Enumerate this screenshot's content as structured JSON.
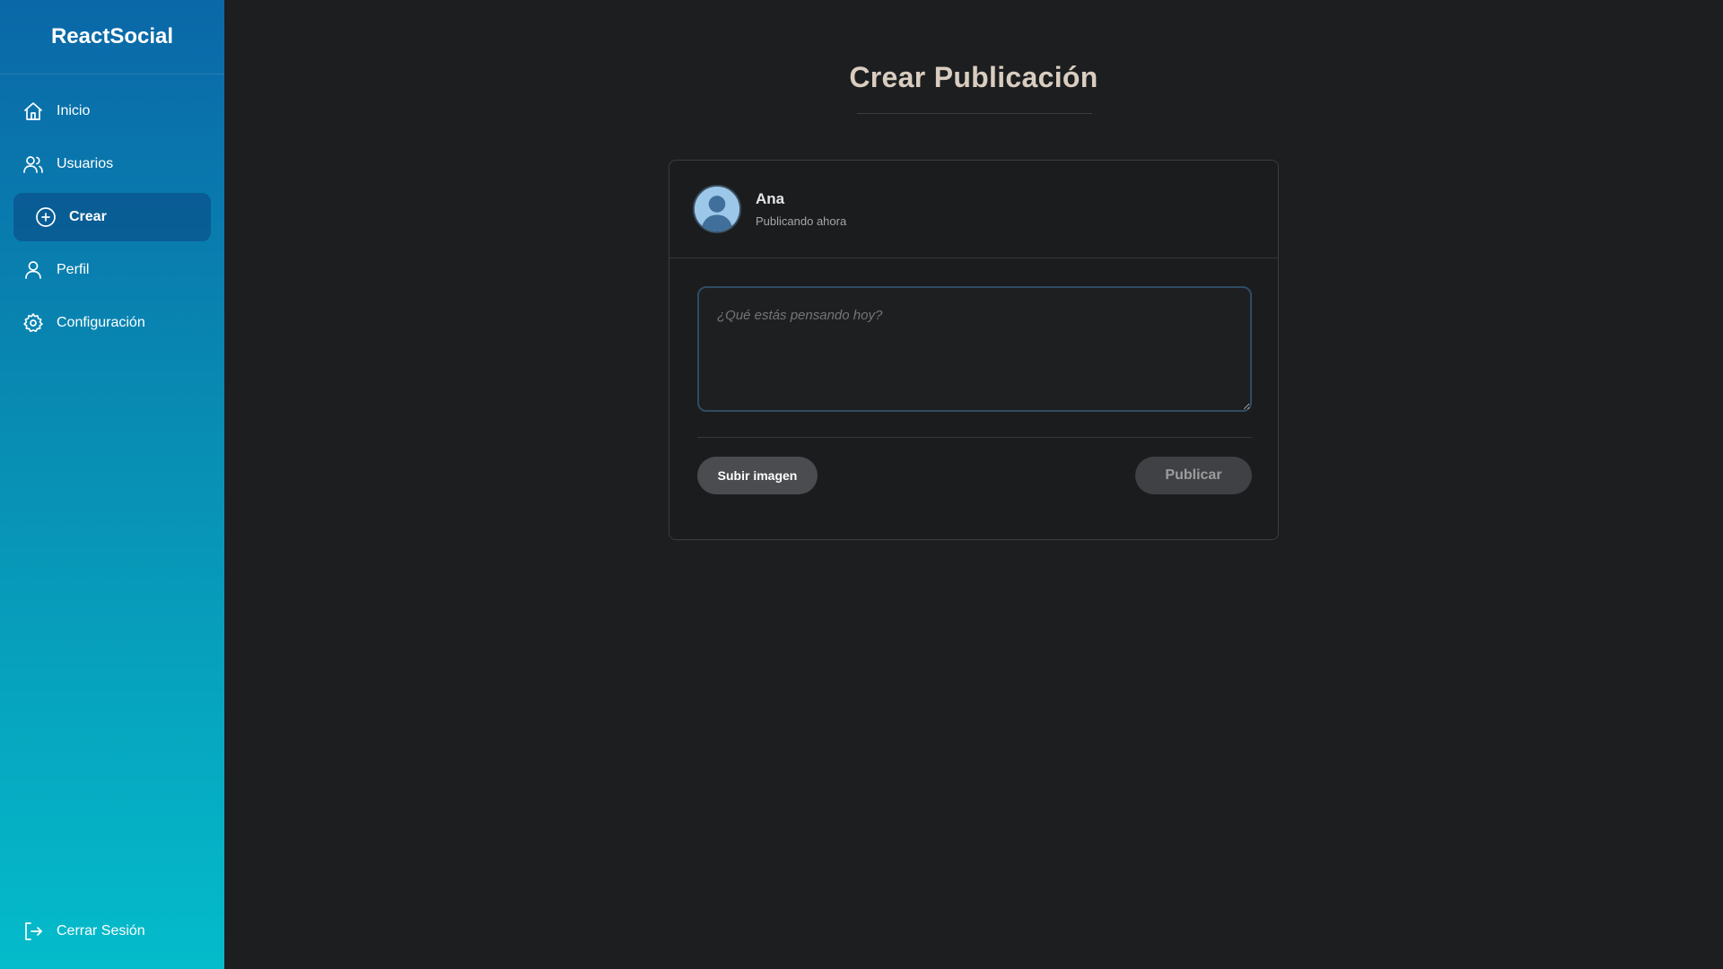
{
  "sidebar": {
    "brand": "ReactSocial",
    "items": [
      {
        "label": "Inicio",
        "icon": "home-icon"
      },
      {
        "label": "Usuarios",
        "icon": "users-icon"
      },
      {
        "label": "Crear",
        "icon": "plus-circle-icon",
        "active": true
      },
      {
        "label": "Perfil",
        "icon": "user-icon"
      },
      {
        "label": "Configuración",
        "icon": "gear-icon"
      }
    ],
    "logout": {
      "label": "Cerrar Sesión",
      "icon": "logout-icon"
    }
  },
  "main": {
    "title": "Crear Publicación",
    "post": {
      "user_name": "Ana",
      "user_status": "Publicando ahora",
      "placeholder": "¿Qué estás pensando hoy?",
      "value": "",
      "upload_label": "Subir imagen",
      "publish_label": "Publicar"
    }
  },
  "colors": {
    "sidebar_top": "#0a68a8",
    "sidebar_bottom": "#04bccb",
    "background": "#1d1e20",
    "title": "#d8cdbf"
  }
}
